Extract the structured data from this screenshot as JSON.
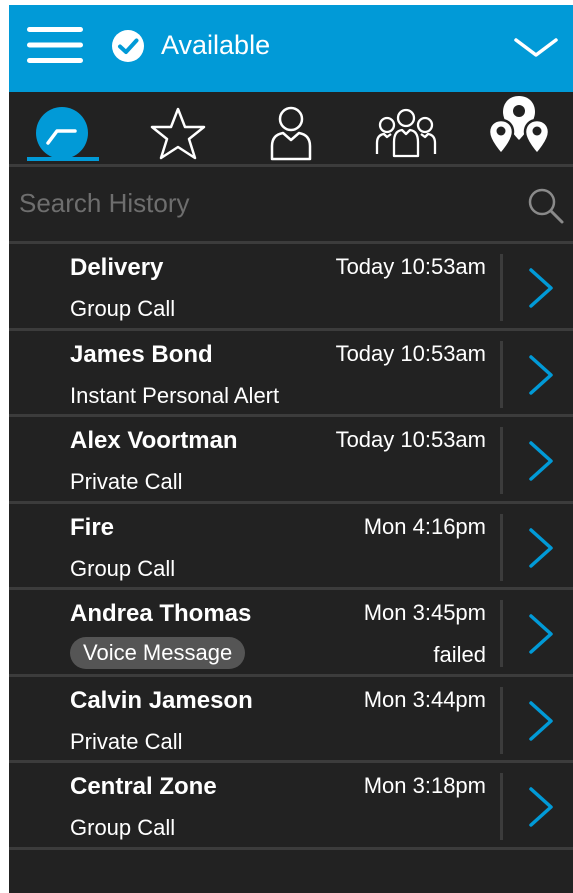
{
  "header": {
    "status_label": "Available",
    "accent_color": "#019ad7",
    "icons": [
      "menu-icon",
      "check-circle-icon",
      "chevron-down-icon"
    ]
  },
  "tabs": [
    {
      "name": "history",
      "icon": "history-clock-icon",
      "active": true
    },
    {
      "name": "favorites",
      "icon": "star-icon",
      "active": false
    },
    {
      "name": "contacts",
      "icon": "person-icon",
      "active": false
    },
    {
      "name": "groups",
      "icon": "group-icon",
      "active": false
    },
    {
      "name": "locations",
      "icon": "map-pins-icon",
      "active": false
    }
  ],
  "search": {
    "placeholder": "Search History",
    "value": ""
  },
  "history": [
    {
      "name": "Delivery",
      "time": "Today 10:53am",
      "subtitle": "Group Call",
      "pill": false,
      "status": ""
    },
    {
      "name": "James Bond",
      "time": "Today 10:53am",
      "subtitle": "Instant Personal Alert",
      "pill": false,
      "status": ""
    },
    {
      "name": "Alex Voortman",
      "time": "Today 10:53am",
      "subtitle": "Private Call",
      "pill": false,
      "status": ""
    },
    {
      "name": "Fire",
      "time": "Mon 4:16pm",
      "subtitle": "Group Call",
      "pill": false,
      "status": ""
    },
    {
      "name": "Andrea Thomas",
      "time": "Mon 3:45pm",
      "subtitle": "Voice Message",
      "pill": true,
      "status": "failed"
    },
    {
      "name": "Calvin Jameson",
      "time": "Mon 3:44pm",
      "subtitle": "Private Call",
      "pill": false,
      "status": ""
    },
    {
      "name": "Central Zone",
      "time": "Mon 3:18pm",
      "subtitle": "Group Call",
      "pill": false,
      "status": ""
    }
  ]
}
